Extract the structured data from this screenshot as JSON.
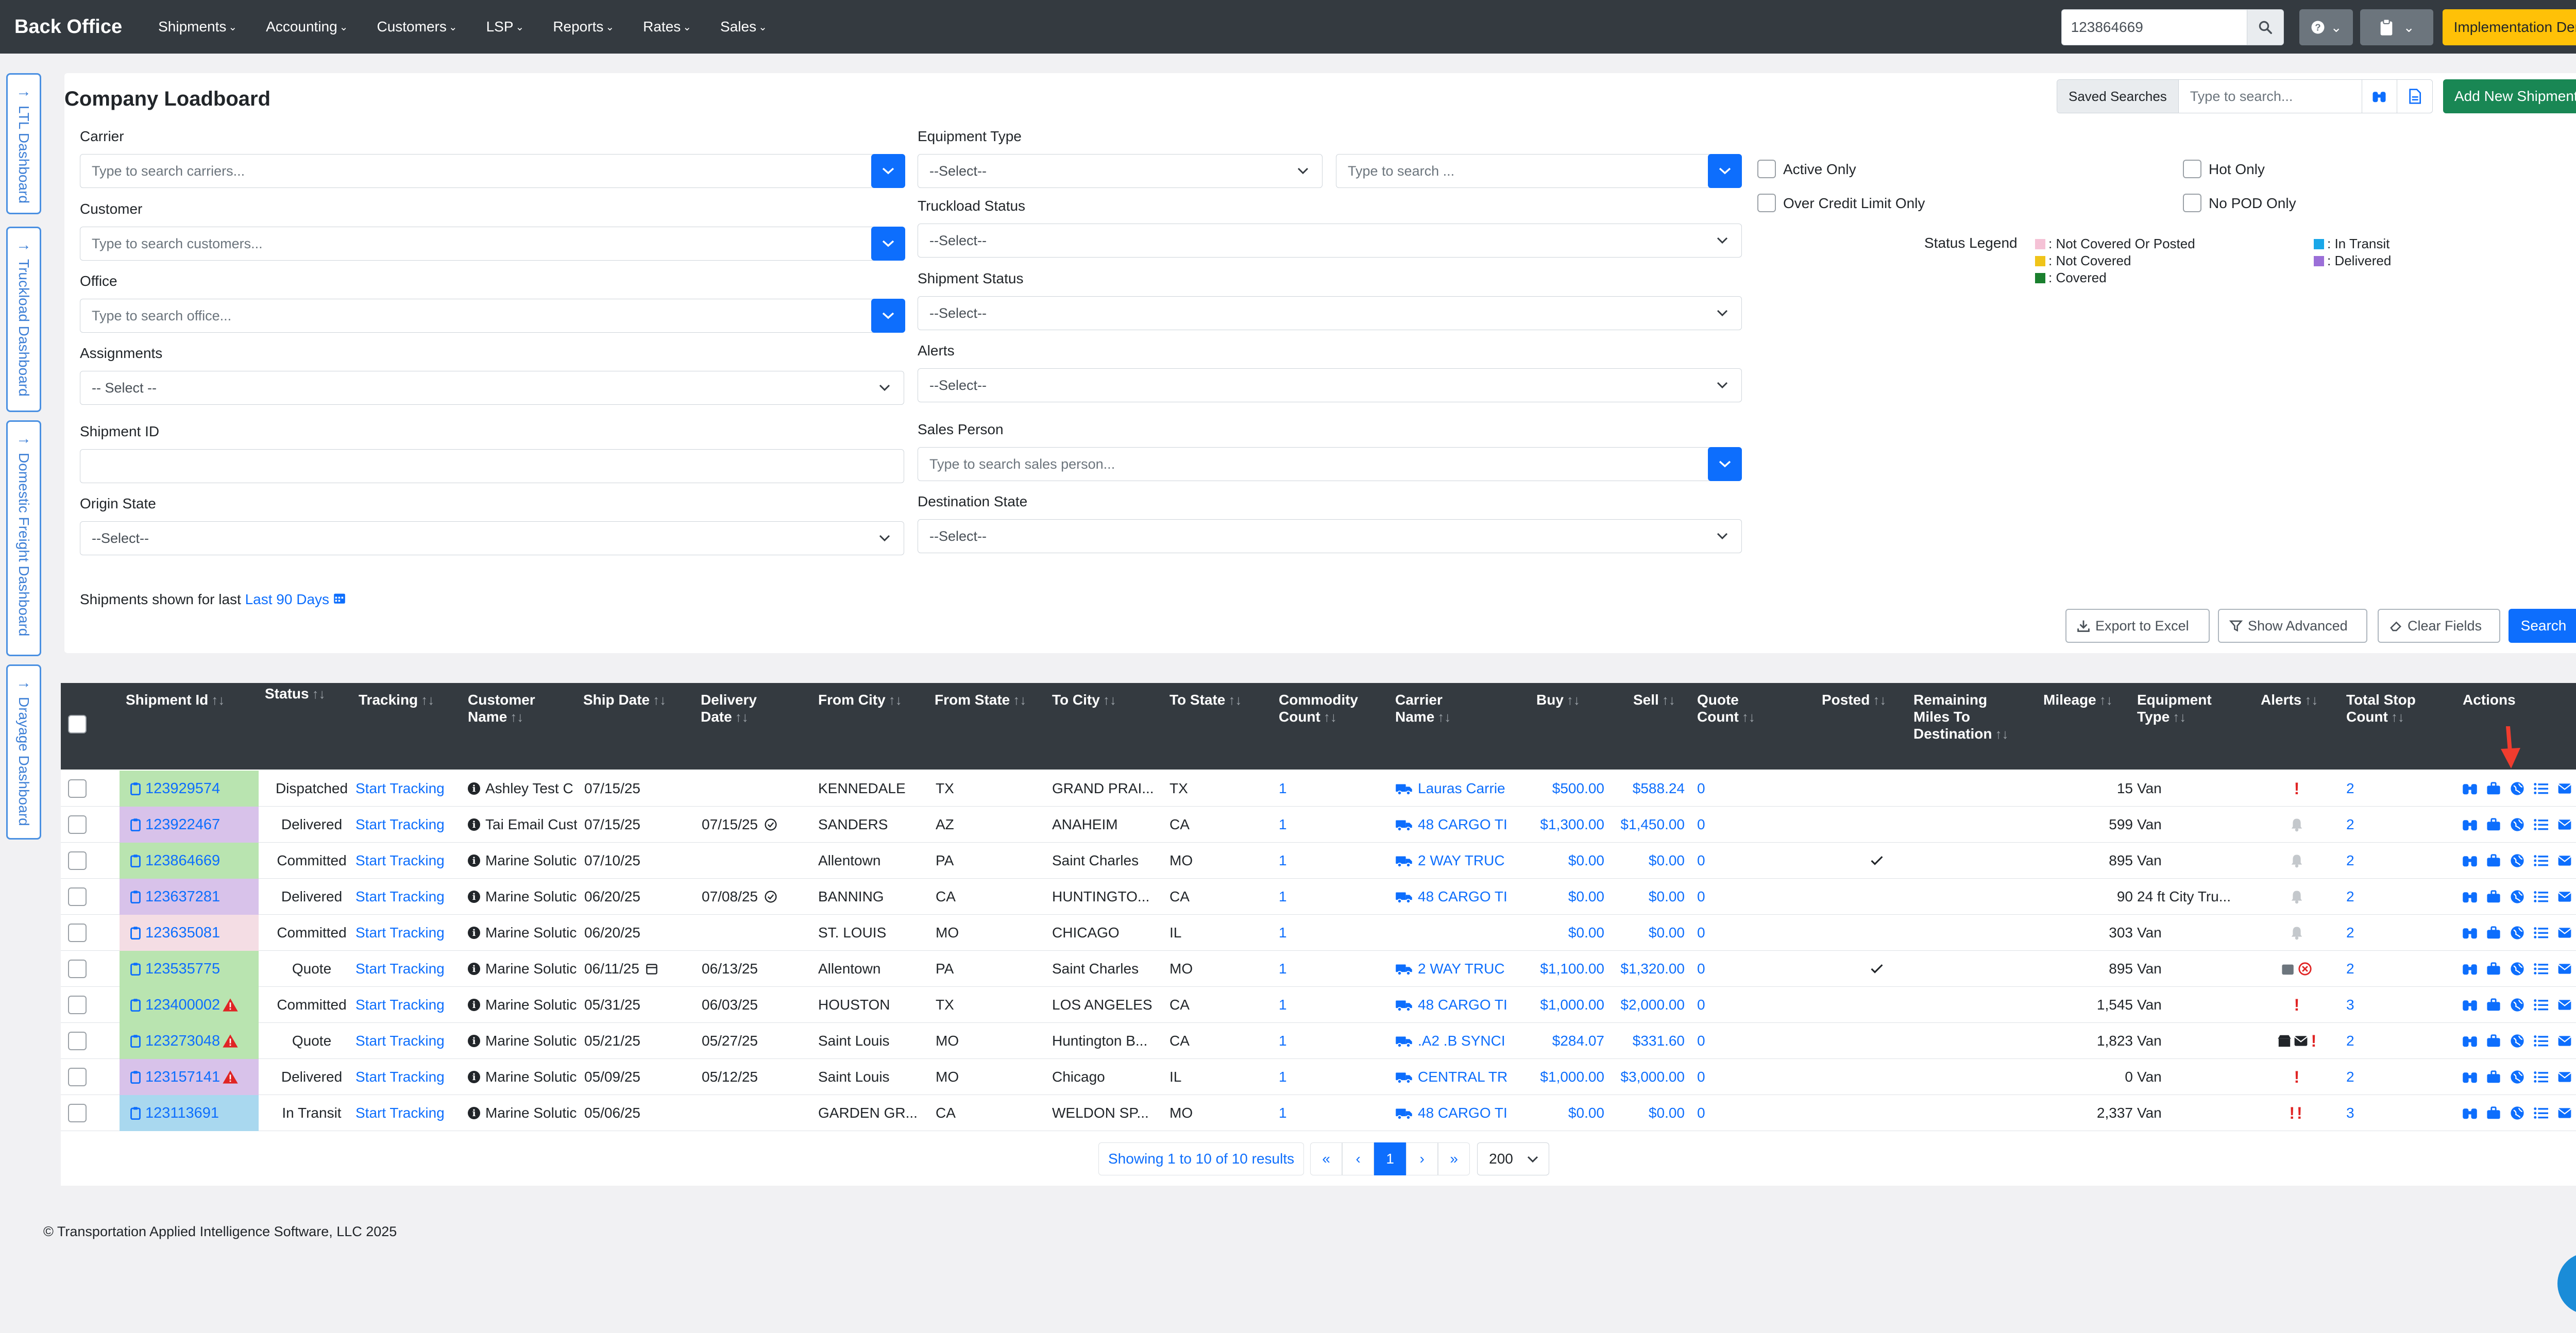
{
  "navbar": {
    "brand": "Back Office",
    "menu": [
      "Shipments",
      "Accounting",
      "Customers",
      "LSP",
      "Reports",
      "Rates",
      "Sales"
    ],
    "search_value": "123864669",
    "env_button": "Implementation Demo"
  },
  "side_tabs": [
    "LTL Dashboard",
    "Truckload Dashboard",
    "Domestic Freight Dashboard",
    "Drayage Dashboard"
  ],
  "page": {
    "title": "Company Loadboard",
    "saved_searches_label": "Saved Searches",
    "saved_searches_placeholder": "Type to search...",
    "add_new_shipment": "Add New Shipment"
  },
  "filters": {
    "carrier": {
      "label": "Carrier",
      "placeholder": "Type to search carriers..."
    },
    "customer": {
      "label": "Customer",
      "placeholder": "Type to search customers..."
    },
    "office": {
      "label": "Office",
      "placeholder": "Type to search office..."
    },
    "assignments": {
      "label": "Assignments",
      "value": "-- Select --"
    },
    "shipment_id": {
      "label": "Shipment ID",
      "value": ""
    },
    "origin_state": {
      "label": "Origin State",
      "value": "--Select--"
    },
    "equipment_type": {
      "label": "Equipment Type",
      "value": "--Select--",
      "search_placeholder": "Type to search ..."
    },
    "truckload_status": {
      "label": "Truckload Status",
      "value": "--Select--"
    },
    "shipment_status": {
      "label": "Shipment Status",
      "value": "--Select--"
    },
    "alerts": {
      "label": "Alerts",
      "value": "--Select--"
    },
    "sales_person": {
      "label": "Sales Person",
      "placeholder": "Type to search sales person..."
    },
    "destination_state": {
      "label": "Destination State",
      "value": "--Select--"
    },
    "checkboxes": {
      "active_only": "Active Only",
      "over_credit_limit_only": "Over Credit Limit Only",
      "hot_only": "Hot Only",
      "no_pod_only": "No POD Only"
    },
    "range_prefix": "Shipments shown for last",
    "range_link": "Last 90 Days"
  },
  "legend": {
    "title": "Status Legend",
    "items": [
      {
        "label": ": Not Covered Or Posted",
        "color": "#f5c2d6"
      },
      {
        "label": ": Not Covered",
        "color": "#f0c419"
      },
      {
        "label": ": Covered",
        "color": "#1a7f2e"
      },
      {
        "label": ": In Transit",
        "color": "#1aa7e8"
      },
      {
        "label": ": Delivered",
        "color": "#9b6fd8"
      }
    ]
  },
  "buttons": {
    "export": "Export to Excel",
    "show_advanced": "Show Advanced",
    "clear_fields": "Clear Fields",
    "search": "Search"
  },
  "table": {
    "headers": {
      "shipment_id": "Shipment Id",
      "status": "Status",
      "tracking": "Tracking",
      "customer_name": "Customer Name",
      "ship_date": "Ship Date",
      "delivery_date": "Delivery Date",
      "from_city": "From City",
      "from_state": "From State",
      "to_city": "To City",
      "to_state": "To State",
      "commodity_count": "Commodity Count",
      "carrier_name": "Carrier Name",
      "buy": "Buy",
      "sell": "Sell",
      "quote_count": "Quote Count",
      "posted": "Posted",
      "remaining_miles": "Remaining Miles To Destination",
      "mileage": "Mileage",
      "equipment_type": "Equipment Type",
      "alerts": "Alerts",
      "total_stop_count": "Total Stop Count",
      "actions": "Actions"
    },
    "rows": [
      {
        "id": "123929574",
        "id_color": "#b9e4b0",
        "warn": false,
        "status": "Dispatched",
        "tracking": "Start Tracking",
        "customer": "Ashley Test C",
        "ship": "07/15/25",
        "ship_cal": false,
        "delivery": "",
        "delivery_check": false,
        "from_city": "KENNEDALE",
        "from_state": "TX",
        "to_city": "GRAND PRAI...",
        "to_state": "TX",
        "commodity": "1",
        "carrier": "Lauras Carrie",
        "buy": "$500.00",
        "sell": "$588.24",
        "quote": "0",
        "posted": "",
        "mileage": "15",
        "equipment": "Van",
        "alert": "excl",
        "stops": "2"
      },
      {
        "id": "123922467",
        "id_color": "#d8c2ea",
        "warn": false,
        "status": "Delivered",
        "tracking": "Start Tracking",
        "customer": "Tai Email Cust",
        "ship": "07/15/25",
        "ship_cal": false,
        "delivery": "07/15/25",
        "delivery_check": true,
        "from_city": "SANDERS",
        "from_state": "AZ",
        "to_city": "ANAHEIM",
        "to_state": "CA",
        "commodity": "1",
        "carrier": "48 CARGO TI",
        "buy": "$1,300.00",
        "sell": "$1,450.00",
        "quote": "0",
        "posted": "",
        "mileage": "599",
        "equipment": "Van",
        "alert": "bell",
        "stops": "2"
      },
      {
        "id": "123864669",
        "id_color": "#b9e4b0",
        "warn": false,
        "status": "Committed",
        "tracking": "Start Tracking",
        "customer": "Marine Solutic",
        "ship": "07/10/25",
        "ship_cal": false,
        "delivery": "",
        "delivery_check": false,
        "from_city": "Allentown",
        "from_state": "PA",
        "to_city": "Saint Charles",
        "to_state": "MO",
        "commodity": "1",
        "carrier": "2 WAY TRUC",
        "buy": "$0.00",
        "sell": "$0.00",
        "quote": "0",
        "posted": "check",
        "mileage": "895",
        "equipment": "Van",
        "alert": "bell",
        "stops": "2"
      },
      {
        "id": "123637281",
        "id_color": "#d8c2ea",
        "warn": false,
        "status": "Delivered",
        "tracking": "Start Tracking",
        "customer": "Marine Solutic",
        "ship": "06/20/25",
        "ship_cal": false,
        "delivery": "07/08/25",
        "delivery_check": true,
        "from_city": "BANNING",
        "from_state": "CA",
        "to_city": "HUNTINGTO...",
        "to_state": "CA",
        "commodity": "1",
        "carrier": "48 CARGO TI",
        "buy": "$0.00",
        "sell": "$0.00",
        "quote": "0",
        "posted": "",
        "mileage": "90",
        "equipment": "24 ft City Tru...",
        "alert": "bell",
        "stops": "2"
      },
      {
        "id": "123635081",
        "id_color": "#f4dde4",
        "warn": false,
        "status": "Committed",
        "tracking": "Start Tracking",
        "customer": "Marine Solutic",
        "ship": "06/20/25",
        "ship_cal": false,
        "delivery": "",
        "delivery_check": false,
        "from_city": "ST. LOUIS",
        "from_state": "MO",
        "to_city": "CHICAGO",
        "to_state": "IL",
        "commodity": "1",
        "carrier": "",
        "buy": "$0.00",
        "sell": "$0.00",
        "quote": "0",
        "posted": "",
        "mileage": "303",
        "equipment": "Van",
        "alert": "bell",
        "stops": "2"
      },
      {
        "id": "123535775",
        "id_color": "#b9e4b0",
        "warn": false,
        "status": "Quote",
        "tracking": "Start Tracking",
        "customer": "Marine Solutic",
        "ship": "06/11/25",
        "ship_cal": true,
        "delivery": "06/13/25",
        "delivery_check": false,
        "from_city": "Allentown",
        "from_state": "PA",
        "to_city": "Saint Charles",
        "to_state": "MO",
        "commodity": "1",
        "carrier": "2 WAY TRUC",
        "buy": "$1,100.00",
        "sell": "$1,320.00",
        "quote": "0",
        "posted": "check",
        "mileage": "895",
        "equipment": "Van",
        "alert": "cal-x",
        "stops": "2"
      },
      {
        "id": "123400002",
        "id_color": "#b9e4b0",
        "warn": true,
        "status": "Committed",
        "tracking": "Start Tracking",
        "customer": "Marine Solutic",
        "ship": "05/31/25",
        "ship_cal": false,
        "delivery": "06/03/25",
        "delivery_check": false,
        "from_city": "HOUSTON",
        "from_state": "TX",
        "to_city": "LOS ANGELES",
        "to_state": "CA",
        "commodity": "1",
        "carrier": "48 CARGO TI",
        "buy": "$1,000.00",
        "sell": "$2,000.00",
        "quote": "0",
        "posted": "",
        "mileage": "1,545",
        "equipment": "Van",
        "alert": "excl",
        "stops": "3"
      },
      {
        "id": "123273048",
        "id_color": "#b9e4b0",
        "warn": true,
        "status": "Quote",
        "tracking": "Start Tracking",
        "customer": "Marine Solutic",
        "ship": "05/21/25",
        "ship_cal": false,
        "delivery": "05/27/25",
        "delivery_check": false,
        "from_city": "Saint Louis",
        "from_state": "MO",
        "to_city": "Huntington B...",
        "to_state": "CA",
        "commodity": "1",
        "carrier": ".A2 .B SYNCI",
        "buy": "$284.07",
        "sell": "$331.60",
        "quote": "0",
        "posted": "",
        "mileage": "1,823",
        "equipment": "Van",
        "alert": "multi",
        "stops": "2"
      },
      {
        "id": "123157141",
        "id_color": "#d8c2ea",
        "warn": true,
        "status": "Delivered",
        "tracking": "Start Tracking",
        "customer": "Marine Solutic",
        "ship": "05/09/25",
        "ship_cal": false,
        "delivery": "05/12/25",
        "delivery_check": false,
        "from_city": "Saint Louis",
        "from_state": "MO",
        "to_city": "Chicago",
        "to_state": "IL",
        "commodity": "1",
        "carrier": "CENTRAL TR",
        "buy": "$1,000.00",
        "sell": "$3,000.00",
        "quote": "0",
        "posted": "",
        "mileage": "0",
        "equipment": "Van",
        "alert": "excl",
        "stops": "2"
      },
      {
        "id": "123113691",
        "id_color": "#a9d8ef",
        "warn": false,
        "status": "In Transit",
        "tracking": "Start Tracking",
        "customer": "Marine Solutic",
        "ship": "05/06/25",
        "ship_cal": false,
        "delivery": "",
        "delivery_check": false,
        "from_city": "GARDEN GR...",
        "from_state": "CA",
        "to_city": "WELDON SP...",
        "to_state": "MO",
        "commodity": "1",
        "carrier": "48 CARGO TI",
        "buy": "$0.00",
        "sell": "$0.00",
        "quote": "0",
        "posted": "",
        "mileage": "2,337",
        "equipment": "Van",
        "alert": "excl2",
        "stops": "3"
      }
    ]
  },
  "pagination": {
    "info": "Showing 1 to 10 of 10 results",
    "first": "«",
    "prev": "‹",
    "current": "1",
    "next": "›",
    "last": "»",
    "page_size": "200"
  },
  "footer": "© Transportation Applied Intelligence Software, LLC 2025",
  "colors": {
    "primary": "#0d6efd",
    "navbar": "#343a40",
    "success": "#198754",
    "warning": "#ffc107",
    "danger": "#dc3545"
  }
}
